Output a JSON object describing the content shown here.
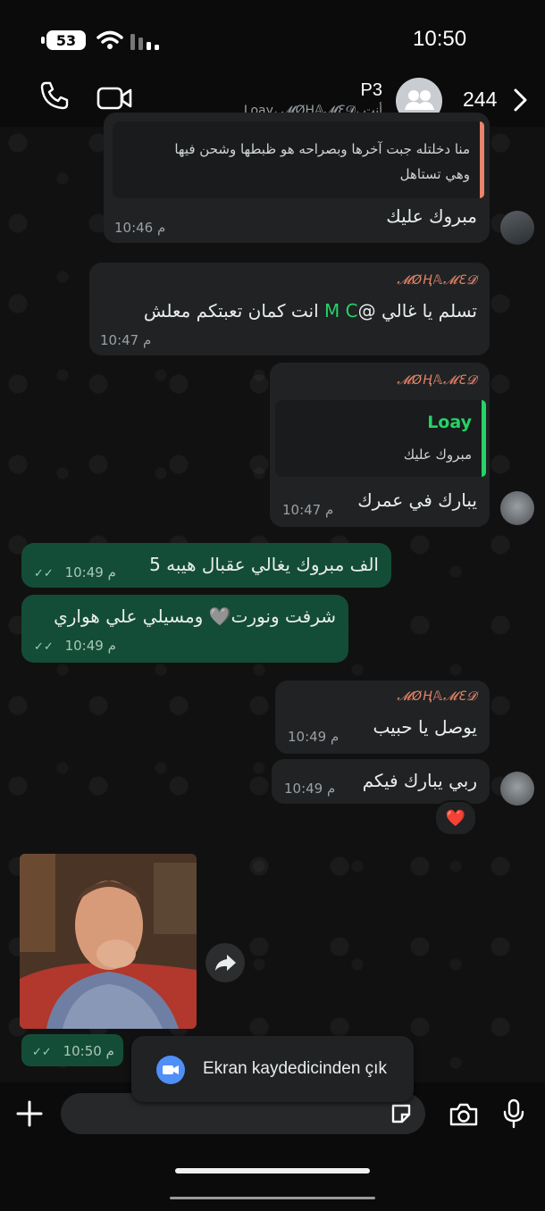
{
  "status_bar": {
    "battery": "53",
    "time": "10:50"
  },
  "header": {
    "group_name": "P3",
    "members_subtitle": "Loay، 𝓜ØⱧ𝔸𝓜Ɛ𝓓، أنت",
    "count": "244",
    "icons": [
      "phone-icon",
      "video-icon",
      "group-avatar-icon",
      "chevron-right-icon"
    ]
  },
  "messages": [
    {
      "id": "m1",
      "direction": "in",
      "quote_text": "منا دخلتله جبت آخرها وبصراحه هو ظبطها وشحن فيها وهي تستاهل",
      "quote_line1": "منا دخلتله جبت آخرها وبصراحه هو ظبطها وشحن فيها",
      "quote_line2": "وهي تستاهل",
      "text": "مبروك عليك",
      "time": "10:46 م"
    },
    {
      "id": "m2",
      "direction": "in",
      "sender": "𝓜ØⱧ𝔸𝓜Ɛ𝓓",
      "text_before_mention": "تسلم يا غالي @",
      "mention": "M C",
      "text_after_mention": " انت كمان تعبتكم معلش",
      "time": "10:47 م"
    },
    {
      "id": "m3",
      "direction": "in",
      "sender": "𝓜ØⱧ𝔸𝓜Ɛ𝓓",
      "quote_author": "Loay",
      "quote_text": "مبروك عليك",
      "text": "يبارك في عمرك",
      "time": "10:47 م"
    },
    {
      "id": "m4",
      "direction": "out",
      "text": "الف مبروك يغالي عقبال هيبه 5",
      "time": "10:49 م"
    },
    {
      "id": "m5",
      "direction": "out",
      "text": "شرفت ونورت🩶 ومسيلي علي هواري",
      "time": "10:49 م"
    },
    {
      "id": "m6",
      "direction": "in",
      "sender": "𝓜ØⱧ𝔸𝓜Ɛ𝓓",
      "text": "يوصل يا حبيب",
      "time": "10:49 م"
    },
    {
      "id": "m7",
      "direction": "in",
      "text": "ربي يبارك فيكم",
      "time": "10:49 م",
      "reaction": "❤️"
    },
    {
      "id": "m8",
      "direction": "out",
      "type": "image",
      "time": "10:50 م"
    }
  ],
  "toast": {
    "text": "Ekran kaydedicinden çık"
  },
  "composer": {
    "placeholder": ""
  },
  "colors": {
    "incoming": "#202223",
    "outgoing": "#144d37",
    "sender": "#e8846b",
    "mention": "#25d366"
  }
}
